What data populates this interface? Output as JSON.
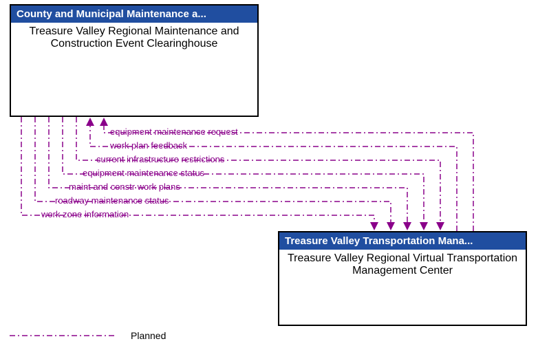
{
  "nodes": {
    "source": {
      "header": "County and Municipal Maintenance a...",
      "body": "Treasure Valley Regional Maintenance and Construction Event Clearinghouse"
    },
    "target": {
      "header": "Treasure Valley Transportation Mana...",
      "body": "Treasure Valley Regional Virtual Transportation Management Center"
    }
  },
  "flows": [
    {
      "label": "equipment maintenance request",
      "direction": "to_source"
    },
    {
      "label": "work plan feedback",
      "direction": "to_source"
    },
    {
      "label": "current infrastructure restrictions",
      "direction": "to_target"
    },
    {
      "label": "equipment maintenance status",
      "direction": "to_target"
    },
    {
      "label": "maint and constr work plans",
      "direction": "to_target"
    },
    {
      "label": "roadway maintenance status",
      "direction": "to_target"
    },
    {
      "label": "work zone information",
      "direction": "to_target"
    }
  ],
  "legend": {
    "label": "Planned"
  },
  "colors": {
    "header_bg": "#204ea0",
    "flow": "#8a008a"
  }
}
